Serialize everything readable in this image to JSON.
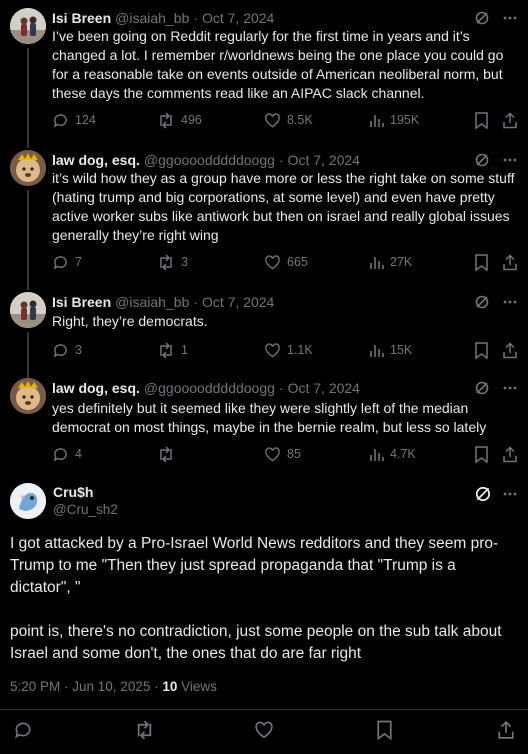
{
  "replies": [
    {
      "name": "Isi Breen",
      "handle": "@isaiah_bb",
      "date": "Oct 7, 2024",
      "text": "I’ve been going on Reddit regularly for the first time in years and it’s changed a lot. I remember r/worldnews being the one place you could go for a reasonable take on events outside of American neoliberal norm, but these days the comments read like an AIPAC slack channel.",
      "replies": "124",
      "reposts": "496",
      "likes": "8.5K",
      "views": "195K"
    },
    {
      "name": "law dog, esq.",
      "handle": "@ggoooodddddoogg",
      "date": "Oct 7, 2024",
      "text": "it’s wild how they as a group have more or less the right take on some stuff (hating trump and big corporations, at some level) and even have pretty active worker subs like antiwork but then on israel and really global issues generally they’re right wing",
      "replies": "7",
      "reposts": "3",
      "likes": "665",
      "views": "27K"
    },
    {
      "name": "Isi Breen",
      "handle": "@isaiah_bb",
      "date": "Oct 7, 2024",
      "text": "Right, they’re democrats.",
      "replies": "3",
      "reposts": "1",
      "likes": "1.1K",
      "views": "15K"
    },
    {
      "name": "law dog, esq.",
      "handle": "@ggoooodddddoogg",
      "date": "Oct 7, 2024",
      "text": "yes definitely but it seemed like they were slightly left of the median democrat on most things, maybe in the bernie realm, but less so lately",
      "replies": "4",
      "reposts": "",
      "likes": "85",
      "views": "4.7K"
    }
  ],
  "main": {
    "name": "Cru$h",
    "handle": "@Cru_sh2",
    "paragraph1": "I got attacked by a Pro-Israel World News redditors and they seem pro-Trump to me \"Then they just spread propaganda that \"Trump is a dictator\", \"",
    "paragraph2": "point is, there's no contradiction, just some people on the sub talk about Israel and some don't, the ones that do are far right",
    "timestamp": "5:20 PM · Jun 10, 2025 · ",
    "views_count": "10",
    "views_label": "Views"
  },
  "colors": {
    "background": "#000000",
    "text": "#e7e9ea",
    "muted": "#71767b",
    "divider": "#2f3336"
  }
}
